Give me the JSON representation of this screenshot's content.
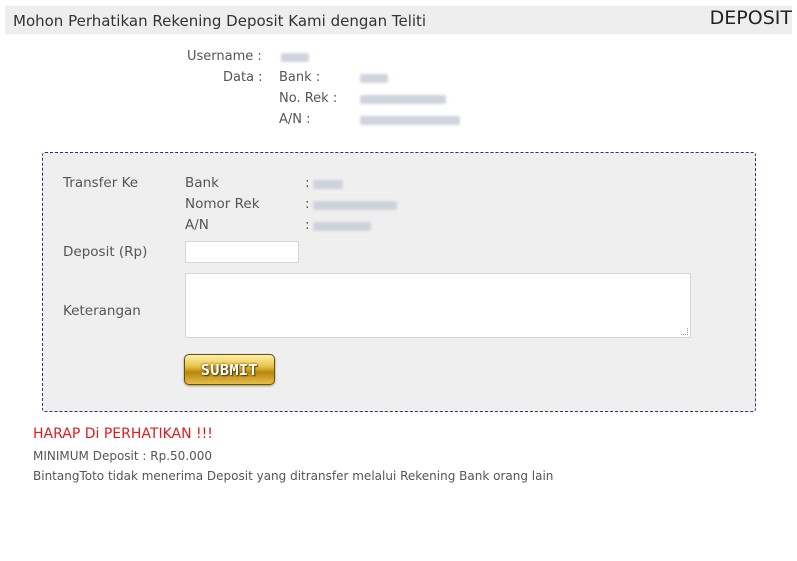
{
  "header": {
    "title": "Mohon Perhatikan Rekening Deposit Kami dengan Teliti",
    "right_label": "DEPOSIT"
  },
  "account": {
    "username_label": "Username :",
    "data_label": "Data :",
    "bank_label": "Bank :",
    "norek_label": "No. Rek :",
    "an_label": "A/N :"
  },
  "form": {
    "transfer_label": "Transfer Ke",
    "bank_label": "Bank",
    "nomor_rek_label": "Nomor Rek",
    "an_label": "A/N",
    "colon": ":",
    "deposit_label": "Deposit (Rp)",
    "deposit_value": "",
    "keterangan_label": "Keterangan",
    "keterangan_value": "",
    "submit_label": "SUBMIT"
  },
  "notice": {
    "title": "HARAP Di PERHATIKAN !!!",
    "minimum": "MINIMUM Deposit : Rp.50.000",
    "policy": "BintangToto tidak menerima Deposit yang ditransfer melalui Rekening Bank orang lain"
  },
  "colors": {
    "warning": "#e01b1b",
    "panel_border": "#31317a",
    "button_gold": "#d4a52a"
  }
}
